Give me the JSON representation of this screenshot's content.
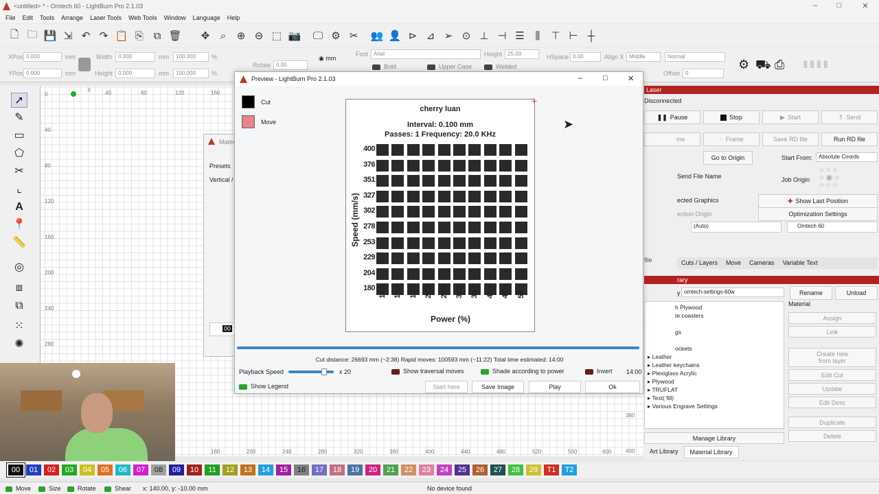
{
  "window": {
    "title": "<untitled> * - Omtech 60 - LightBurn Pro 2.1.03"
  },
  "menu": [
    "File",
    "Edit",
    "Tools",
    "Arrange",
    "Laser Tools",
    "Web Tools",
    "Window",
    "Language",
    "Help"
  ],
  "props": {
    "xpos_label": "XPos",
    "xpos": "0.000",
    "ypos_label": "YPos",
    "ypos": "0.000",
    "width_label": "Width",
    "width": "0.000",
    "height_label": "Height",
    "height": "0.000",
    "pct1": "100.000",
    "pct2": "100.000",
    "unit_mm": "mm",
    "pct": "%",
    "rotate_label": "Rotate",
    "rotate": "0.00",
    "mm_radio": "mm",
    "font_label": "Font",
    "font": "Arial",
    "fheight_label": "Height",
    "fheight": "25.00",
    "hspace_label": "HSpace",
    "hspace": "0.00",
    "alignx_label": "Align X",
    "alignx": "Middle",
    "normal": "Normal",
    "bold": "Bold",
    "upper": "Upper Case",
    "welded": "Welded",
    "offset_label": "Offset",
    "offset": "0"
  },
  "ruler": {
    "x": [
      "X",
      "40",
      "80",
      "120",
      "160"
    ],
    "y": [
      "0",
      "40",
      "80",
      "120",
      "160",
      "200",
      "240",
      "280"
    ],
    "bottom": [
      "160",
      "200",
      "240",
      "280",
      "320",
      "360",
      "400",
      "440",
      "480",
      "520",
      "560",
      "600"
    ],
    "right": [
      "360",
      "400"
    ]
  },
  "material_dialog": {
    "title": "Mater",
    "presets": "Presets",
    "vertical": "Vertical /",
    "field": "00"
  },
  "preview": {
    "title": "Preview - LightBurn Pro 2.1.03",
    "legend": [
      {
        "label": "Cut",
        "color": "#000000"
      },
      {
        "label": "Move",
        "color": "#e8838a"
      }
    ],
    "stats": "Cut distance: 26693 mm (~2:38)   Rapid moves: 100593 mm (~11:22)   Total time estimated: 14:00",
    "playback_label": "Playback Speed",
    "speed_mult": "x 20",
    "show_traversal": "Show traversal moves",
    "shade": "Shade according to power",
    "invert": "Invert",
    "time": "14:00",
    "show_legend": "Show Legend",
    "start_here": "Start here",
    "save_image": "Save Image",
    "play": "Play",
    "ok": "Ok",
    "progress": 1.0
  },
  "chart_data": {
    "type": "heatmap",
    "title": "cherry luan",
    "subtitle": "Interval: 0.100 mm",
    "subtitle2": "Passes: 1  Frequency: 20.0 KHz",
    "ylabel": "Speed (mm/s)",
    "xlabel": "Power (%)",
    "y": [
      "400",
      "376",
      "351",
      "327",
      "302",
      "278",
      "253",
      "229",
      "204",
      "180"
    ],
    "x": [
      "10.0",
      "14.4",
      "18.9",
      "23.3",
      "27.8",
      "32.2",
      "36.7",
      "41.1",
      "45.6",
      "50.0"
    ],
    "cells_filled": true
  },
  "laser": {
    "title": "Laser",
    "status": "Disconnected",
    "pause": "Pause",
    "stop": "Stop",
    "start": "Start",
    "send": "Send",
    "frame_left": "me",
    "frame": "Frame",
    "save_rd": "Save RD file",
    "run_rd": "Run RD file",
    "go_origin": "Go to Origin",
    "start_from_label": "Start From:",
    "start_from": "Absolute Coords",
    "send_file_name": "Send File Name",
    "job_origin": "Job Origin",
    "selected_graphics": "ected Graphics",
    "show_last": "Show Last Position",
    "selection_origin": "ection Origin",
    "optimization": "Optimization Settings",
    "auto": "(Auto)",
    "device": "Omtech 60",
    "file_btn": "file",
    "close_btn": "lose"
  },
  "tabs": [
    "Cuts / Layers",
    "Move",
    "Cameras",
    "Variable Text"
  ],
  "library": {
    "title": "rary",
    "file_prefix": "y",
    "file": "omtech-settings-60w",
    "rename": "Rename",
    "unload": "Unload",
    "material_label": "Material",
    "items": [
      "h Plywood",
      "te coasters",
      "",
      "gs",
      "",
      "ockets",
      "Leather",
      "Leather keychains",
      "Plexiglass Acrylic",
      "Plywood",
      "TRUFLAT",
      "Text( fill)",
      "Various Engrave Settings"
    ],
    "assign": "Assign",
    "link": "Link",
    "create_new": "Create new from layer",
    "edit_cut": "Edit Cut",
    "update": "Update",
    "edit_desc": "Edit Desc",
    "duplicate": "Duplicate",
    "delete": "Delete",
    "manage": "Manage Library",
    "art_tab": "Art Library",
    "mat_tab": "Material Library"
  },
  "palette": [
    {
      "n": "00",
      "c": "#111111"
    },
    {
      "n": "01",
      "c": "#1f3fbf"
    },
    {
      "n": "02",
      "c": "#d62020"
    },
    {
      "n": "03",
      "c": "#22a822"
    },
    {
      "n": "04",
      "c": "#c8c020"
    },
    {
      "n": "05",
      "c": "#e07020"
    },
    {
      "n": "06",
      "c": "#20b8c8"
    },
    {
      "n": "07",
      "c": "#d020d0"
    },
    {
      "n": "08",
      "c": "#a0a0a0"
    },
    {
      "n": "09",
      "c": "#2020a0"
    },
    {
      "n": "10",
      "c": "#a02020"
    },
    {
      "n": "11",
      "c": "#20a020"
    },
    {
      "n": "12",
      "c": "#a0a020"
    },
    {
      "n": "13",
      "c": "#c07020"
    },
    {
      "n": "14",
      "c": "#20a0e0"
    },
    {
      "n": "15",
      "c": "#a020a0"
    },
    {
      "n": "16",
      "c": "#808080"
    },
    {
      "n": "17",
      "c": "#7070c0"
    },
    {
      "n": "18",
      "c": "#c07080"
    },
    {
      "n": "19",
      "c": "#5070a0"
    },
    {
      "n": "20",
      "c": "#d02080"
    },
    {
      "n": "21",
      "c": "#50a050"
    },
    {
      "n": "22",
      "c": "#d09060"
    },
    {
      "n": "23",
      "c": "#e080a0"
    },
    {
      "n": "24",
      "c": "#c040c0"
    },
    {
      "n": "25",
      "c": "#503090"
    },
    {
      "n": "26",
      "c": "#b06030"
    },
    {
      "n": "27",
      "c": "#205050"
    },
    {
      "n": "28",
      "c": "#40c040"
    },
    {
      "n": "29",
      "c": "#d0c030"
    },
    {
      "n": "T1",
      "c": "#d03020"
    },
    {
      "n": "T2",
      "c": "#20a0e0"
    }
  ],
  "status": {
    "move": "Move",
    "size": "Size",
    "rotate": "Rotate",
    "shear": "Shear",
    "coords": "x: 140.00, y: -10.00 mm",
    "device": "No device found"
  }
}
